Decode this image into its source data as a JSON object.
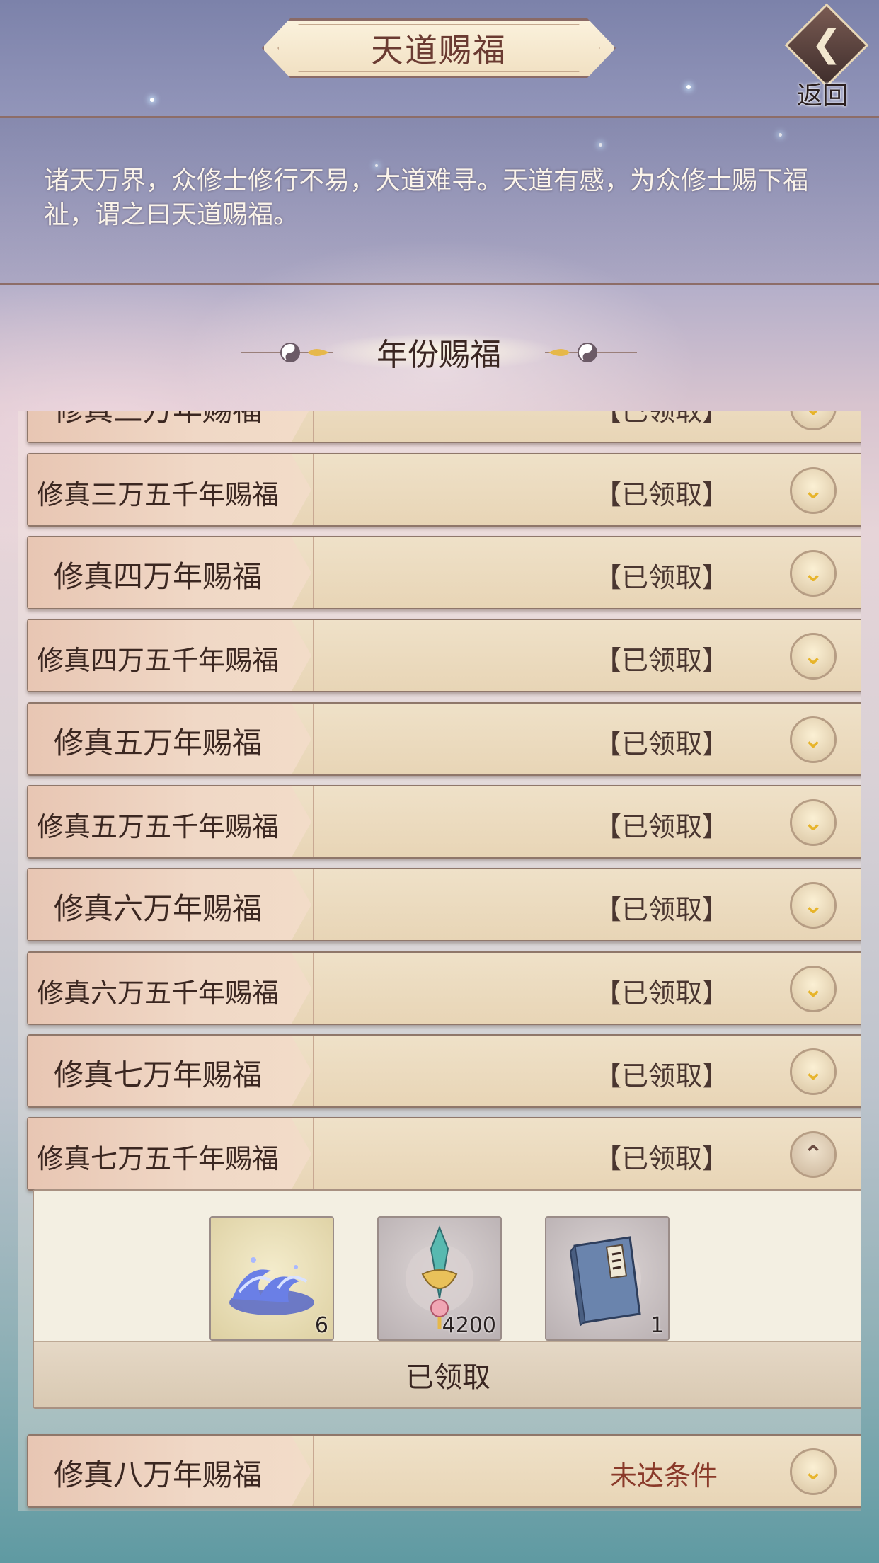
{
  "header": {
    "title": "天道赐福",
    "back_label": "返回"
  },
  "description": "诸天万界，众修士修行不易，大道难寻。天道有感，为众修士赐下福祉，谓之曰天道赐福。",
  "section": {
    "title": "年份赐福"
  },
  "rows": [
    {
      "title": "修真三万年赐福",
      "status": "【已领取】"
    },
    {
      "title": "修真三万五千年赐福",
      "status": "【已领取】"
    },
    {
      "title": "修真四万年赐福",
      "status": "【已领取】"
    },
    {
      "title": "修真四万五千年赐福",
      "status": "【已领取】"
    },
    {
      "title": "修真五万年赐福",
      "status": "【已领取】"
    },
    {
      "title": "修真五万五千年赐福",
      "status": "【已领取】"
    },
    {
      "title": "修真六万年赐福",
      "status": "【已领取】"
    },
    {
      "title": "修真六万五千年赐福",
      "status": "【已领取】"
    },
    {
      "title": "修真七万年赐福",
      "status": "【已领取】"
    },
    {
      "title": "修真七万五千年赐福",
      "status": "【已领取】"
    },
    {
      "title": "修真八万年赐福",
      "status": "未达条件"
    }
  ],
  "expanded": {
    "items": [
      {
        "icon": "water-wave-icon",
        "count": "6"
      },
      {
        "icon": "jade-sword-icon",
        "count": "4200"
      },
      {
        "icon": "scripture-book-icon",
        "count": "1"
      }
    ],
    "claim_label": "已领取"
  },
  "colors": {
    "accent_gold": "#e7b42a",
    "title_text": "#6b3b32",
    "row_bg": "#e8d5b6",
    "pending_text": "#8a3a2a"
  }
}
